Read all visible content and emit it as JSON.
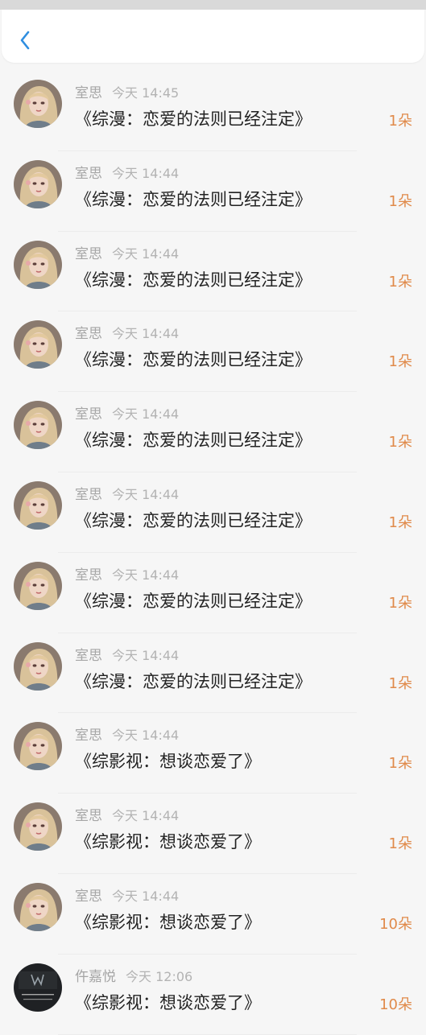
{
  "header": {
    "back_icon": "chevron-left-icon"
  },
  "gifts": [
    {
      "name": "室思",
      "time": "今天 14:45",
      "title": "《综漫：恋爱的法则已经注定》",
      "amount": "1朵",
      "avatar": "girl"
    },
    {
      "name": "室思",
      "time": "今天 14:44",
      "title": "《综漫：恋爱的法则已经注定》",
      "amount": "1朵",
      "avatar": "girl"
    },
    {
      "name": "室思",
      "time": "今天 14:44",
      "title": "《综漫：恋爱的法则已经注定》",
      "amount": "1朵",
      "avatar": "girl"
    },
    {
      "name": "室思",
      "time": "今天 14:44",
      "title": "《综漫：恋爱的法则已经注定》",
      "amount": "1朵",
      "avatar": "girl"
    },
    {
      "name": "室思",
      "time": "今天 14:44",
      "title": "《综漫：恋爱的法则已经注定》",
      "amount": "1朵",
      "avatar": "girl"
    },
    {
      "name": "室思",
      "time": "今天 14:44",
      "title": "《综漫：恋爱的法则已经注定》",
      "amount": "1朵",
      "avatar": "girl"
    },
    {
      "name": "室思",
      "time": "今天 14:44",
      "title": "《综漫：恋爱的法则已经注定》",
      "amount": "1朵",
      "avatar": "girl"
    },
    {
      "name": "室思",
      "time": "今天 14:44",
      "title": "《综漫：恋爱的法则已经注定》",
      "amount": "1朵",
      "avatar": "girl"
    },
    {
      "name": "室思",
      "time": "今天 14:44",
      "title": "《综影视：想谈恋爱了》",
      "amount": "1朵",
      "avatar": "girl"
    },
    {
      "name": "室思",
      "time": "今天 14:44",
      "title": "《综影视：想谈恋爱了》",
      "amount": "1朵",
      "avatar": "girl"
    },
    {
      "name": "室思",
      "time": "今天 14:44",
      "title": "《综影视：想谈恋爱了》",
      "amount": "10朵",
      "avatar": "girl"
    },
    {
      "name": "仵嘉悦",
      "time": "今天 12:06",
      "title": "《综影视：想谈恋爱了》",
      "amount": "10朵",
      "avatar": "dark"
    }
  ],
  "colors": {
    "accent": "#2f8ee0",
    "amount": "#e08a4a"
  }
}
